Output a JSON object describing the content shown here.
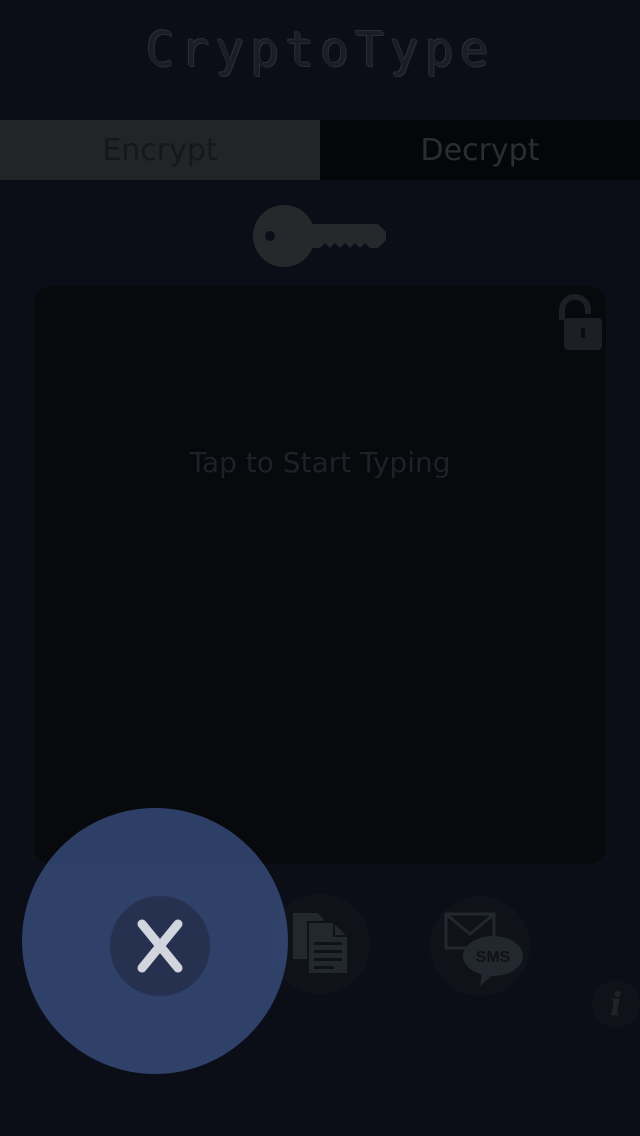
{
  "app": {
    "title": "CryptoType"
  },
  "tabs": [
    {
      "label": "Encrypt",
      "active": true
    },
    {
      "label": "Decrypt",
      "active": false
    }
  ],
  "editor": {
    "placeholder": "Tap to Start Typing",
    "lock_state": "unlocked"
  },
  "actions": {
    "clear_icon": "x-icon",
    "copy_icon": "copy-icon",
    "sms_icon": "sms-icon",
    "sms_label": "SMS",
    "info_label": "i"
  },
  "colors": {
    "background": "#0b0e16",
    "highlight": "#3a4e82",
    "active_tab": "#222428"
  }
}
